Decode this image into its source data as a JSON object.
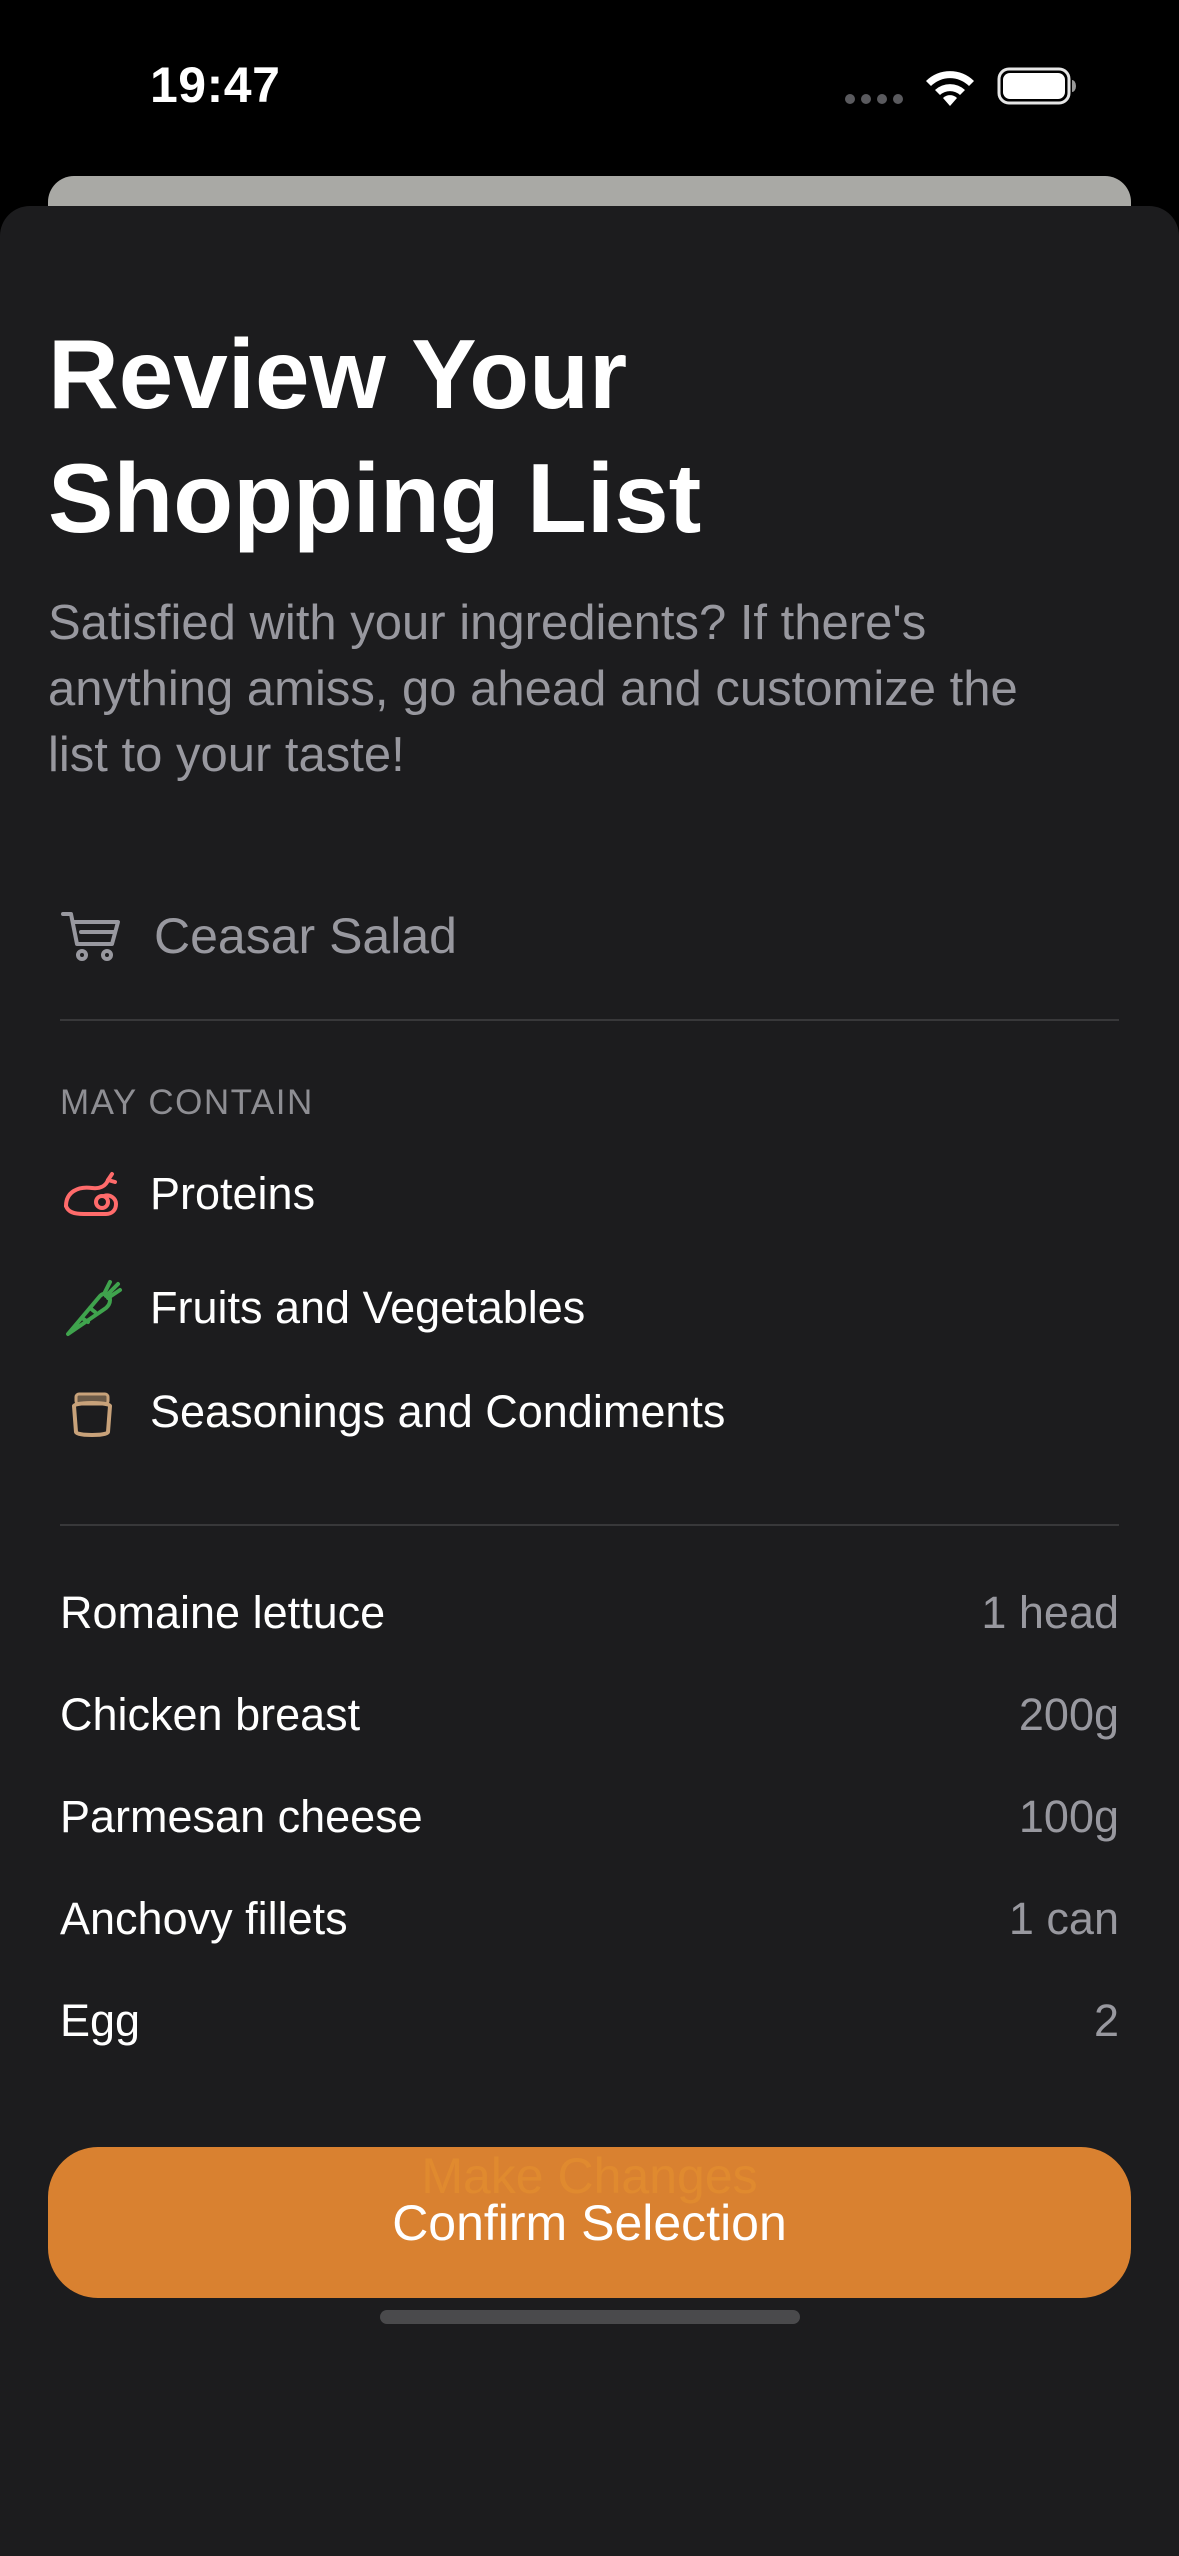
{
  "status_bar": {
    "time": "19:47"
  },
  "sheet": {
    "title_line1": "Review Your",
    "title_line2": "Shopping List",
    "subtitle_line1": "Satisfied with your ingredients? If there's",
    "subtitle_line2": "anything amiss, go ahead and customize the",
    "subtitle_line3": "list to your taste!",
    "recipe": {
      "icon": "cart-icon",
      "name": "Ceasar Salad"
    },
    "may_contain_label": "MAY CONTAIN",
    "categories": [
      {
        "icon": "chicken-leg-icon",
        "label": "Proteins",
        "color": "#ff6b6b"
      },
      {
        "icon": "carrot-icon",
        "label": "Fruits and Vegetables",
        "color": "#3fa34d"
      },
      {
        "icon": "jar-icon",
        "label": "Seasonings and Condiments",
        "color": "#c8a27a"
      }
    ],
    "ingredients": [
      {
        "name": "Romaine lettuce",
        "quantity": "1 head"
      },
      {
        "name": "Chicken breast",
        "quantity": "200g"
      },
      {
        "name": "Parmesan cheese",
        "quantity": "100g"
      },
      {
        "name": "Anchovy fillets",
        "quantity": "1 can"
      },
      {
        "name": "Egg",
        "quantity": "2"
      }
    ],
    "confirm_label": "Confirm Selection",
    "changes_label": "Make Changes"
  },
  "colors": {
    "accent": "#d98130",
    "sheet_background": "#1c1c1e",
    "secondary_text": "#98989f"
  }
}
